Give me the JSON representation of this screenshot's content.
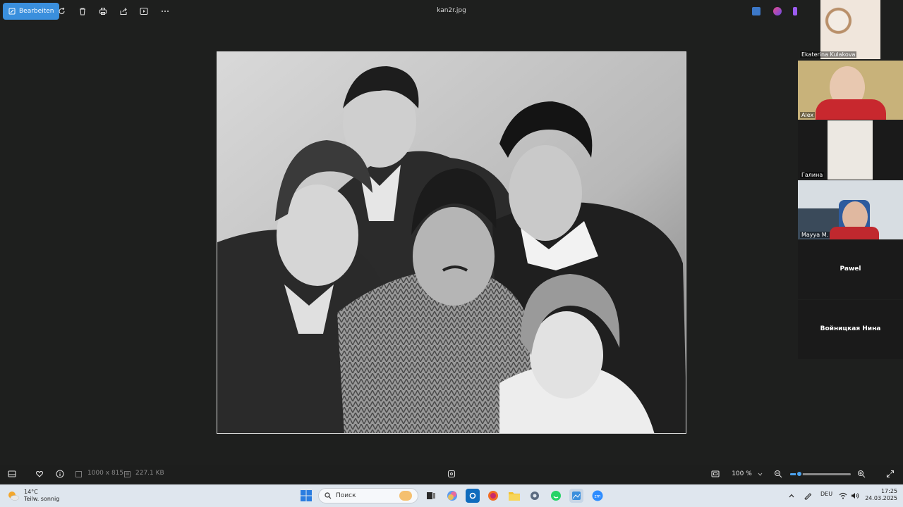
{
  "toolbar": {
    "edit_label": "Bearbeiten",
    "filename": "kan2r.jpg",
    "icons": [
      "edit-icon",
      "rotate-icon",
      "delete-icon",
      "print-icon",
      "share-icon",
      "slideshow-icon",
      "more-icon"
    ]
  },
  "participants": [
    {
      "name": "Ekaterina Kulakova"
    },
    {
      "name": "Alex"
    },
    {
      "name": "Галина"
    },
    {
      "name": "Mayya M."
    },
    {
      "name": "Pawel"
    },
    {
      "name": "Войницкая Нина"
    }
  ],
  "bottombar": {
    "dimensions": "1000 x 815",
    "filesize": "227.1 KB",
    "zoom": "100 %",
    "zoom_level": 0.15
  },
  "taskbar": {
    "temperature": "14°C",
    "weather": "Teilw. sonnig",
    "search_placeholder": "Поиск",
    "language": "DEU",
    "time": "17:25",
    "date": "24.03.2025"
  },
  "colors": {
    "accent": "#3a8fdd",
    "background": "#1e1f1e",
    "taskbar": "#dfe6ee"
  }
}
